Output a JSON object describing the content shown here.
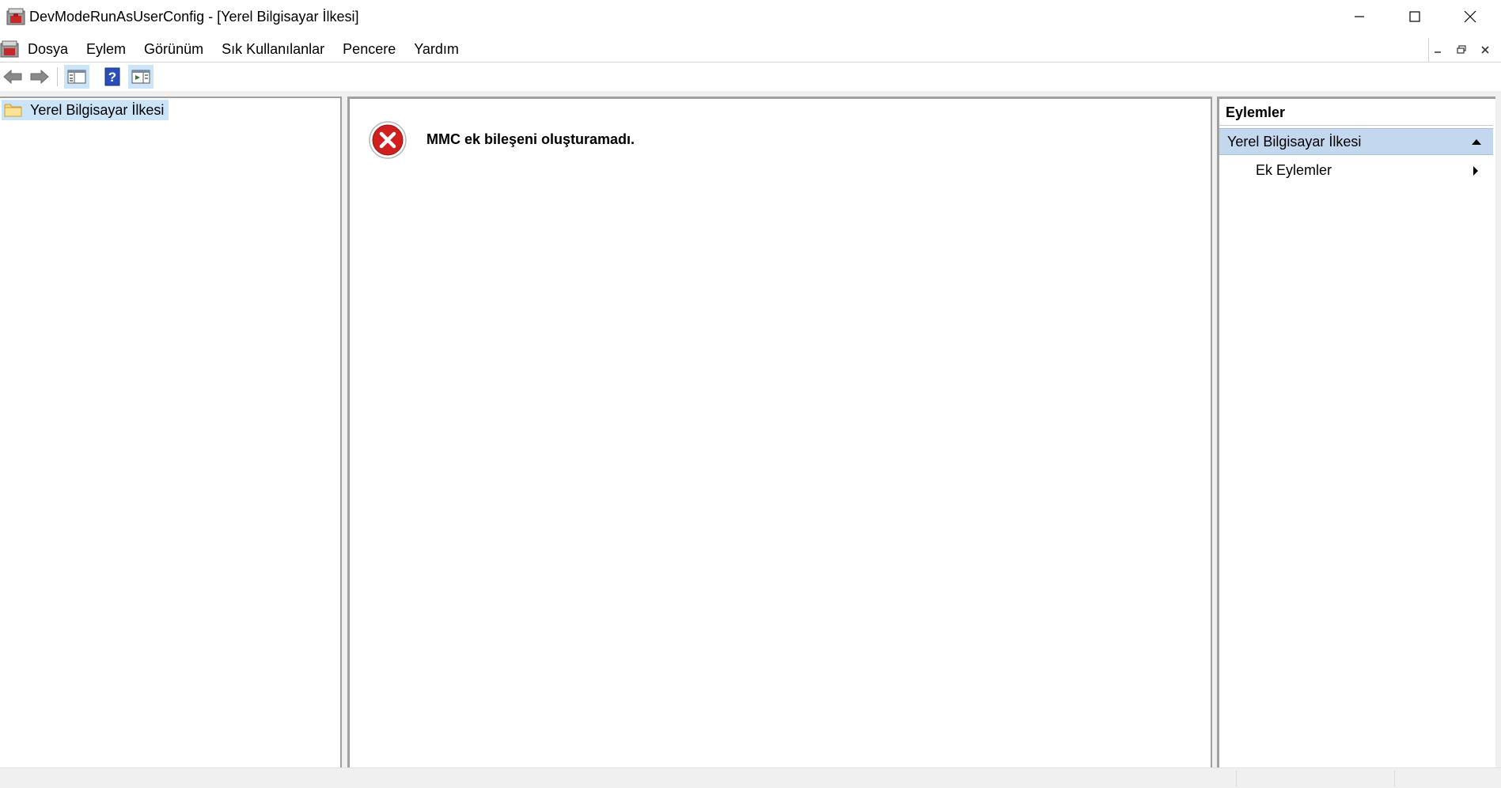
{
  "window": {
    "title": "DevModeRunAsUserConfig - [Yerel Bilgisayar İlkesi]"
  },
  "menu": {
    "items": [
      "Dosya",
      "Eylem",
      "Görünüm",
      "Sık Kullanılanlar",
      "Pencere",
      "Yardım"
    ]
  },
  "toolbar": {
    "buttons": [
      "back-icon",
      "forward-icon",
      "show-hide-console-tree-icon",
      "help-icon",
      "show-hide-action-pane-icon"
    ]
  },
  "tree": {
    "root_label": "Yerel Bilgisayar İlkesi"
  },
  "center": {
    "error_message": "MMC ek bileşeni oluşturamadı."
  },
  "actions": {
    "title": "Eylemler",
    "section_label": "Yerel Bilgisayar İlkesi",
    "items": [
      {
        "label": "Ek Eylemler"
      }
    ]
  },
  "colors": {
    "selection": "#cce4f7",
    "actions_section": "#c3d8ee",
    "error_red": "#d01f1f"
  }
}
